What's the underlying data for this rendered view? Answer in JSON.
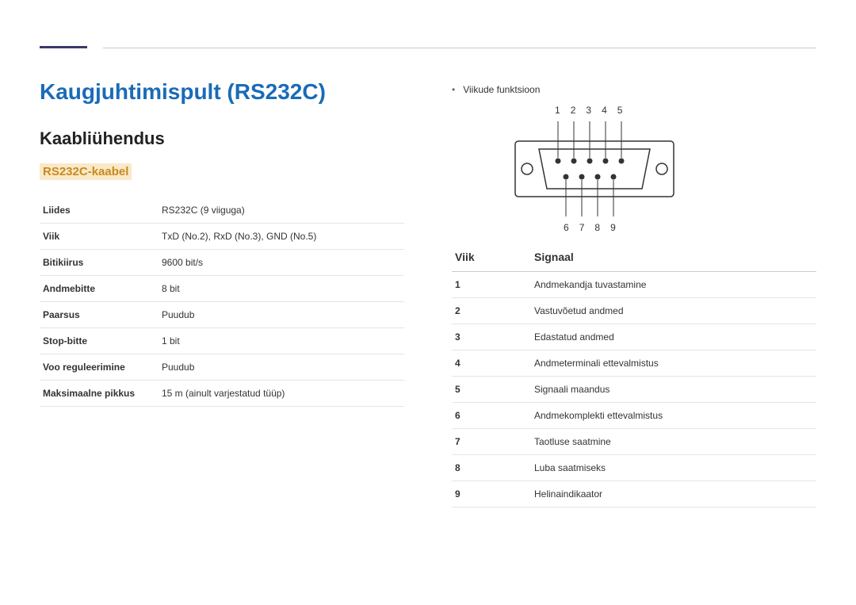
{
  "title": "Kaugjuhtimispult (RS232C)",
  "subtitle": "Kaabliühendus",
  "cableHeading": "RS232C-kaabel",
  "specs": [
    {
      "label": "Liides",
      "value": "RS232C (9 viiguga)"
    },
    {
      "label": "Viik",
      "value": "TxD (No.2), RxD (No.3), GND (No.5)"
    },
    {
      "label": "Bitikiirus",
      "value": "9600 bit/s"
    },
    {
      "label": "Andmebitte",
      "value": "8 bit"
    },
    {
      "label": "Paarsus",
      "value": "Puudub"
    },
    {
      "label": "Stop-bitte",
      "value": "1 bit"
    },
    {
      "label": "Voo reguleerimine",
      "value": "Puudub"
    },
    {
      "label": "Maksimaalne pikkus",
      "value": "15 m (ainult varjestatud tüüp)"
    }
  ],
  "pinFunctionLabel": "Viikude funktsioon",
  "pinTop": [
    "1",
    "2",
    "3",
    "4",
    "5"
  ],
  "pinBottom": [
    "6",
    "7",
    "8",
    "9"
  ],
  "signalHeaders": {
    "pin": "Viik",
    "sig": "Signaal"
  },
  "signals": [
    {
      "pin": "1",
      "sig": "Andmekandja tuvastamine"
    },
    {
      "pin": "2",
      "sig": "Vastuvõetud andmed"
    },
    {
      "pin": "3",
      "sig": "Edastatud andmed"
    },
    {
      "pin": "4",
      "sig": "Andmeterminali ettevalmistus"
    },
    {
      "pin": "5",
      "sig": "Signaali maandus"
    },
    {
      "pin": "6",
      "sig": "Andmekomplekti ettevalmistus"
    },
    {
      "pin": "7",
      "sig": "Taotluse saatmine"
    },
    {
      "pin": "8",
      "sig": "Luba saatmiseks"
    },
    {
      "pin": "9",
      "sig": "Helinaindikaator"
    }
  ]
}
